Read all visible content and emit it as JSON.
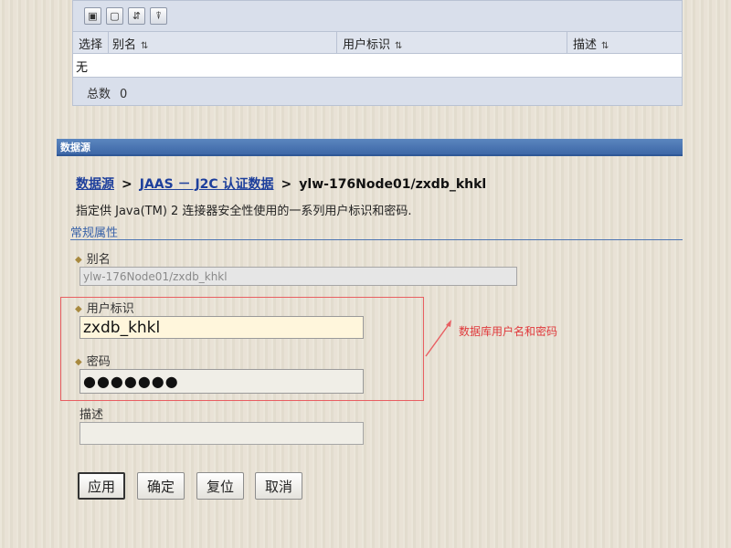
{
  "table": {
    "toolbar_icons": [
      "select-all-icon",
      "deselect-all-icon",
      "filter-icon",
      "clear-filter-icon"
    ],
    "columns": [
      {
        "label": "选择"
      },
      {
        "label": "别名",
        "sort_glyph": "⇅"
      },
      {
        "label": "用户标识",
        "sort_glyph": "⇅"
      },
      {
        "label": "描述",
        "sort_glyph": "⇅"
      }
    ],
    "empty_text": "无",
    "total_label": "总数",
    "total_value": "0"
  },
  "section": {
    "header": "数据源",
    "title": "常规属性"
  },
  "breadcrumb": {
    "items": [
      {
        "label": "数据源",
        "link": true
      },
      {
        "label": "JAAS － J2C 认证数据",
        "link": true
      },
      {
        "label": "ylw-176Node01/zxdb_khkl",
        "link": false
      }
    ],
    "separator": ">"
  },
  "page_description": "指定供 Java(TM) 2 连接器安全性使用的一系列用户标识和密码.",
  "form": {
    "alias": {
      "label": "别名",
      "value": "ylw-176Node01/zxdb_khkl",
      "required_mark": "◆"
    },
    "user_id": {
      "label": "用户标识",
      "value": "zxdb_khkl",
      "required_mark": "◆"
    },
    "password": {
      "label": "密码",
      "value": "●●●●●●●",
      "required_mark": "◆"
    },
    "description": {
      "label": "描述",
      "value": ""
    }
  },
  "annotation": {
    "text": "数据库用户名和密码",
    "color": "#e0393c"
  },
  "buttons": {
    "apply": "应用",
    "ok": "确定",
    "reset": "复位",
    "cancel": "取消"
  },
  "colors": {
    "section_bar": "#3d67a7",
    "link": "#1d3f9c",
    "annotation": "#e85f62"
  }
}
